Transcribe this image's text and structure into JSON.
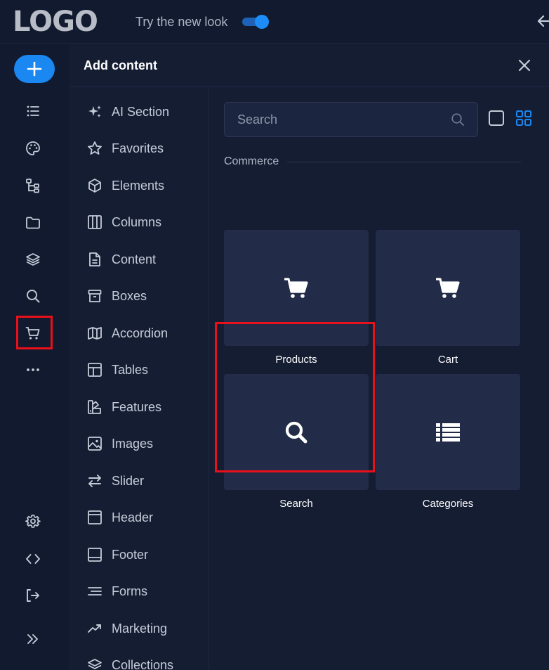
{
  "topbar": {
    "logo": "LOGO",
    "try_new_look": "Try the new look",
    "toggle_on": true
  },
  "rail": {
    "icons": [
      "list-icon",
      "palette-icon",
      "sitemap-icon",
      "folder-icon",
      "layers-icon",
      "search-icon",
      "cart-icon",
      "more-icon",
      "settings-icon",
      "code-icon",
      "logout-icon",
      "expand-icon"
    ],
    "highlighted": "cart-icon"
  },
  "panel": {
    "title": "Add content",
    "categories": [
      {
        "label": "AI Section",
        "icon": "sparkles-icon"
      },
      {
        "label": "Favorites",
        "icon": "star-icon"
      },
      {
        "label": "Elements",
        "icon": "cube-icon"
      },
      {
        "label": "Columns",
        "icon": "columns-icon"
      },
      {
        "label": "Content",
        "icon": "document-icon"
      },
      {
        "label": "Boxes",
        "icon": "box-icon"
      },
      {
        "label": "Accordion",
        "icon": "map-icon"
      },
      {
        "label": "Tables",
        "icon": "table-icon"
      },
      {
        "label": "Features",
        "icon": "shapes-icon"
      },
      {
        "label": "Images",
        "icon": "image-icon"
      },
      {
        "label": "Slider",
        "icon": "arrows-icon"
      },
      {
        "label": "Header",
        "icon": "header-icon"
      },
      {
        "label": "Footer",
        "icon": "footer-icon"
      },
      {
        "label": "Forms",
        "icon": "forms-icon"
      },
      {
        "label": "Marketing",
        "icon": "trend-icon"
      },
      {
        "label": "Collections",
        "icon": "stack-icon"
      }
    ],
    "search": {
      "placeholder": "Search",
      "value": ""
    },
    "section": "Commerce",
    "tiles": [
      {
        "label": "Products",
        "icon": "cart-icon"
      },
      {
        "label": "Cart",
        "icon": "cart-icon"
      },
      {
        "label": "Search",
        "icon": "search-icon"
      },
      {
        "label": "Categories",
        "icon": "list-icon"
      }
    ],
    "highlighted_tile": "Search"
  },
  "colors": {
    "accent": "#1b87f0",
    "highlight": "#e8101a",
    "panel_bg": "#151d33",
    "rail_bg": "#111a2e",
    "tile_bg": "#222b47"
  }
}
